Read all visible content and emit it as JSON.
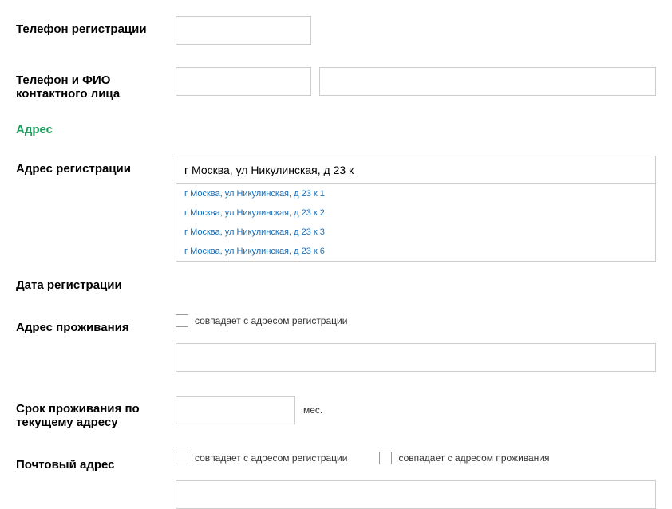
{
  "labels": {
    "reg_phone": "Телефон регистрации",
    "contact_phone_name": "Телефон и ФИО контактного лица",
    "address_section": "Адрес",
    "reg_address": "Адрес регистрации",
    "reg_date": "Дата регистрации",
    "residence_address": "Адрес проживания",
    "residence_duration": "Срок проживания по текущему адресу",
    "postal_address": "Почтовый адрес"
  },
  "values": {
    "reg_phone": "",
    "contact_phone": "",
    "contact_name": "",
    "reg_address": "г Москва, ул Никулинская, д 23 к",
    "reg_date": "",
    "residence_address": "",
    "residence_duration": "",
    "postal_address": ""
  },
  "checkboxes": {
    "residence_same_as_reg": "совпадает с адресом регистрации",
    "postal_same_as_reg": "совпадает с адресом регистрации",
    "postal_same_as_residence": "совпадает с адресом проживания"
  },
  "units": {
    "months": "мес."
  },
  "autocomplete": [
    "г Москва, ул Никулинская, д 23 к 1",
    "г Москва, ул Никулинская, д 23 к 2",
    "г Москва, ул Никулинская, д 23 к 3",
    "г Москва, ул Никулинская, д 23 к 6"
  ]
}
